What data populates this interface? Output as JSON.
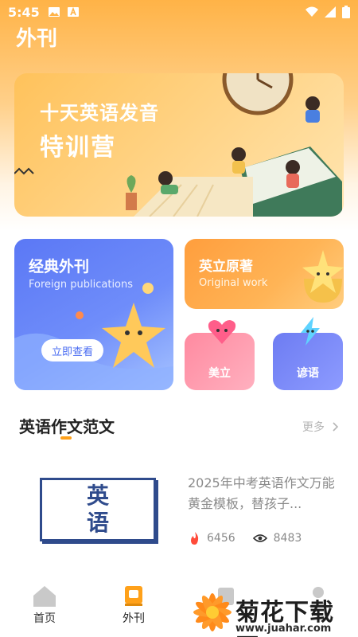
{
  "status_bar": {
    "time": "5:45"
  },
  "page_title": "外刊",
  "banner": {
    "line1": "十天英语发音",
    "line2": "特训营"
  },
  "cards": {
    "classic": {
      "title": "经典外刊",
      "subtitle": "Foreign publications",
      "button": "立即查看"
    },
    "original": {
      "title": "英立原著",
      "subtitle": "Original work"
    },
    "meili": {
      "title": "美立"
    },
    "yanyu": {
      "title": "谚语"
    }
  },
  "section": {
    "title": "英语作文范文",
    "more": "更多"
  },
  "article": {
    "thumb_line1": "英",
    "thumb_line2": "语",
    "title": "2025年中考英语作文万能黄金模板，替孩子...",
    "likes": "6456",
    "views": "8483"
  },
  "nav": {
    "home": "首页",
    "waikan": "外刊"
  },
  "watermark": {
    "text": "菊花下载网",
    "url": "www.juahar.com"
  },
  "colors": {
    "accent": "#ffa11a",
    "blue": "#5b78f5",
    "orange": "#ff9e3d"
  }
}
